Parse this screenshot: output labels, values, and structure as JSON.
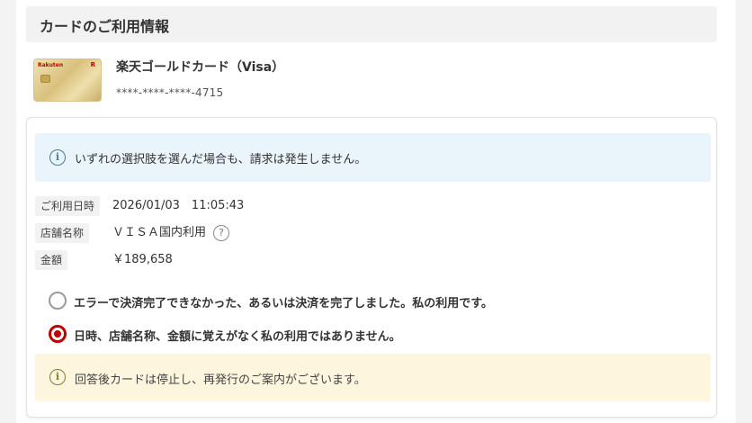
{
  "section": {
    "title": "カードのご利用情報"
  },
  "card": {
    "name": "楽天ゴールドカード（Visa）",
    "number": "****-****-****-4715",
    "brand_text": "Rakuten",
    "brand_mark": "R"
  },
  "notice": {
    "icon": "info-icon",
    "text": "いずれの選択肢を選んだ場合も、請求は発生しません。"
  },
  "details": [
    {
      "label": "ご利用日時",
      "value": "2026/01/03　11:05:43"
    },
    {
      "label": "店舗名称",
      "value": "ＶＩＳＡ国内利用"
    },
    {
      "label": "金額",
      "value": "￥189,658"
    }
  ],
  "help_glyph": "?",
  "info_glyph": "i",
  "options": [
    {
      "label": "エラーで決済完了できなかった、あるいは決済を完了しました。私の利用です。",
      "checked": false
    },
    {
      "label": "日時、店舗名称、金額に覚えがなく私の利用ではありません。",
      "checked": true
    }
  ],
  "notice_bottom": {
    "icon": "info-icon",
    "text": "回答後カードは停止し、再発行のご案内がございます。"
  },
  "colors": {
    "accent": "#bf0000",
    "info_bg": "#e9f4fb",
    "warn_bg": "#fdf5dd"
  }
}
